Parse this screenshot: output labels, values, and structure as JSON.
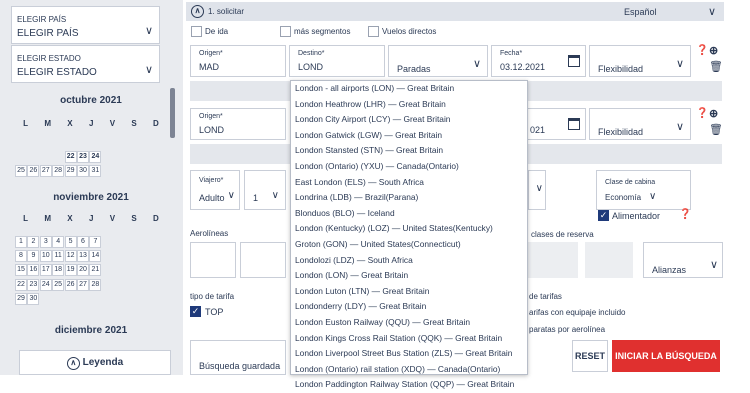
{
  "sidebar": {
    "country": {
      "label": "ELEGIR PAÍS",
      "value": "ELEGIR PAÍS"
    },
    "state": {
      "label": "ELEGIR ESTADO",
      "value": "ELEGIR ESTADO"
    },
    "weekdays": [
      "L",
      "M",
      "X",
      "J",
      "V",
      "S",
      "D"
    ],
    "months": [
      {
        "name": "octubre 2021",
        "days": [
          "22",
          "23",
          "24",
          "25",
          "26",
          "27",
          "28",
          "29",
          "30",
          "31"
        ]
      },
      {
        "name": "noviembre 2021",
        "days": [
          "1",
          "2",
          "3",
          "4",
          "5",
          "6",
          "7",
          "8",
          "9",
          "10",
          "11",
          "12",
          "13",
          "14",
          "15",
          "16",
          "17",
          "18",
          "19",
          "20",
          "21",
          "22",
          "23",
          "24",
          "25",
          "26",
          "27",
          "28",
          "29",
          "30"
        ]
      },
      {
        "name": "diciembre 2021"
      }
    ],
    "legend_label": "Leyenda"
  },
  "header": {
    "step_label": "1. solicitar",
    "language": "Español",
    "options": [
      {
        "label": "De ida",
        "checked": false
      },
      {
        "label": "más segmentos",
        "checked": false
      },
      {
        "label": "Vuelos directos",
        "checked": false
      }
    ]
  },
  "segment1": {
    "origin_label": "Origen*",
    "origin_value": "MAD",
    "dest_label": "Destino*",
    "dest_value": "LOND",
    "stops_placeholder": "Paradas",
    "date_label": "Fecha*",
    "date_value": "03.12.2021",
    "flex_placeholder": "Flexibilidad"
  },
  "segment2": {
    "origin_label": "Origen*",
    "origin_value": "LOND",
    "date_value_partial": "021",
    "flex_placeholder": "Flexibilidad"
  },
  "travelers": {
    "label": "Viajero*",
    "type": "Adulto",
    "count": "1"
  },
  "cabin": {
    "label": "Clase de cabina",
    "value": "Economía",
    "feeder_label": "Alimentador"
  },
  "airlines_label": "Aerolíneas",
  "booking_classes_label": "clases de reserva",
  "alliances_placeholder": "Alianzas",
  "fare_type_label": "tipo de tarifa",
  "top_label": "TOP",
  "fare_options": [
    "de tarifas",
    "arifas con equipaje incluido",
    "paratas por aerolínea"
  ],
  "saved_search_placeholder": "Búsqueda guardada",
  "buttons": {
    "reset": "RESET",
    "search": "INICIAR LA BÚSQUEDA"
  },
  "destination_suggestions": [
    "London - all airports (LON) — Great Britain",
    "London Heathrow (LHR) — Great Britain",
    "London City Airport (LCY) — Great Britain",
    "London Gatwick (LGW) — Great Britain",
    "London Stansted (STN) — Great Britain",
    "London (Ontario) (YXU) — Canada(Ontario)",
    "East London (ELS) — South Africa",
    "Londrina (LDB) — Brazil(Parana)",
    "Blonduos (BLO) — Iceland",
    "London (Kentucky) (LOZ) — United States(Kentucky)",
    "Groton (GON) — United States(Connecticut)",
    "Londolozi (LDZ) — South Africa",
    "London (LON) — Great Britain",
    "London Luton (LTN) — Great Britain",
    "Londonderry (LDY) — Great Britain",
    "London Euston Railway (QQU) — Great Britain",
    "London Kings Cross Rail Station (QQK) — Great Britain",
    "London Liverpool Street Bus Station (ZLS) — Great Britain",
    "London (Ontario) rail station (XDQ) — Canada(Ontario)",
    "London Paddington Railway Station (QQP) — Great Britain"
  ],
  "colors": {
    "accent": "#e0302f",
    "navy": "#1f3a7a",
    "sidebar": "#e9ebef"
  }
}
